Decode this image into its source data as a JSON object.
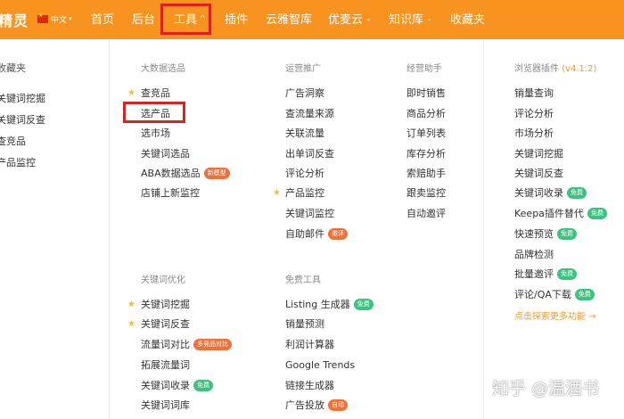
{
  "topnav": {
    "brand": "精灵",
    "lang": "中文",
    "items": [
      "首页",
      "后台",
      "工具",
      "插件",
      "云雅智库",
      "优麦云",
      "知识库",
      "收藏夹"
    ]
  },
  "left": {
    "title": "收藏夹",
    "items": [
      "关键词挖掘",
      "关键词反查",
      "查竞品",
      "产品监控"
    ]
  },
  "sections": {
    "big_data": {
      "title": "大数据选品",
      "items": [
        "查竞品",
        "选产品",
        "选市场",
        "关键词选品",
        "ABA数据选品",
        "店铺上新监控"
      ],
      "aba_badge": "新模型"
    },
    "ops": {
      "title": "运营推广",
      "items": [
        "广告洞察",
        "查流量来源",
        "关联流量",
        "出单词反查",
        "评论分析",
        "产品监控",
        "关键词监控",
        "自助邮件"
      ],
      "mail_badge": "邀评"
    },
    "ops_assist": {
      "title": "经营助手",
      "items": [
        "即时销售",
        "商品分析",
        "订单列表",
        "库存分析",
        "索赔助手",
        "跟卖监控",
        "自动邀评"
      ]
    },
    "plugin": {
      "title": "浏览器插件",
      "version": "(v4.1.2)",
      "items": [
        "销量查询",
        "评论分析",
        "市场分析",
        "关键词挖掘",
        "关键词反查",
        "关键词收录",
        "Keepa插件替代",
        "快速预览",
        "品牌检测",
        "批量邀评",
        "评论/QA下载"
      ],
      "badge_free": "免费",
      "more": "点击探索更多功能 →"
    },
    "keyword": {
      "title": "关键词优化",
      "items": [
        "关键词挖掘",
        "关键词反查",
        "流量词对比",
        "拓展流量词",
        "关键词收录",
        "关键词词库"
      ],
      "compare_badge": "多竞品对比",
      "free_badge": "免费"
    },
    "free_tools": {
      "title": "免费工具",
      "items": [
        "Listing 生成器",
        "销量预测",
        "利润计算器",
        "Google Trends",
        "链接生成器",
        "广告投放"
      ],
      "free_badge": "免费",
      "auto_badge": "自动"
    }
  },
  "watermark": "知乎 @温酒书",
  "colors": {
    "nav": "#f7931e",
    "highlight": "#e0201b",
    "star": "#f6b93b",
    "badge_orange": "#f0703a",
    "badge_green": "#3dc27f"
  }
}
